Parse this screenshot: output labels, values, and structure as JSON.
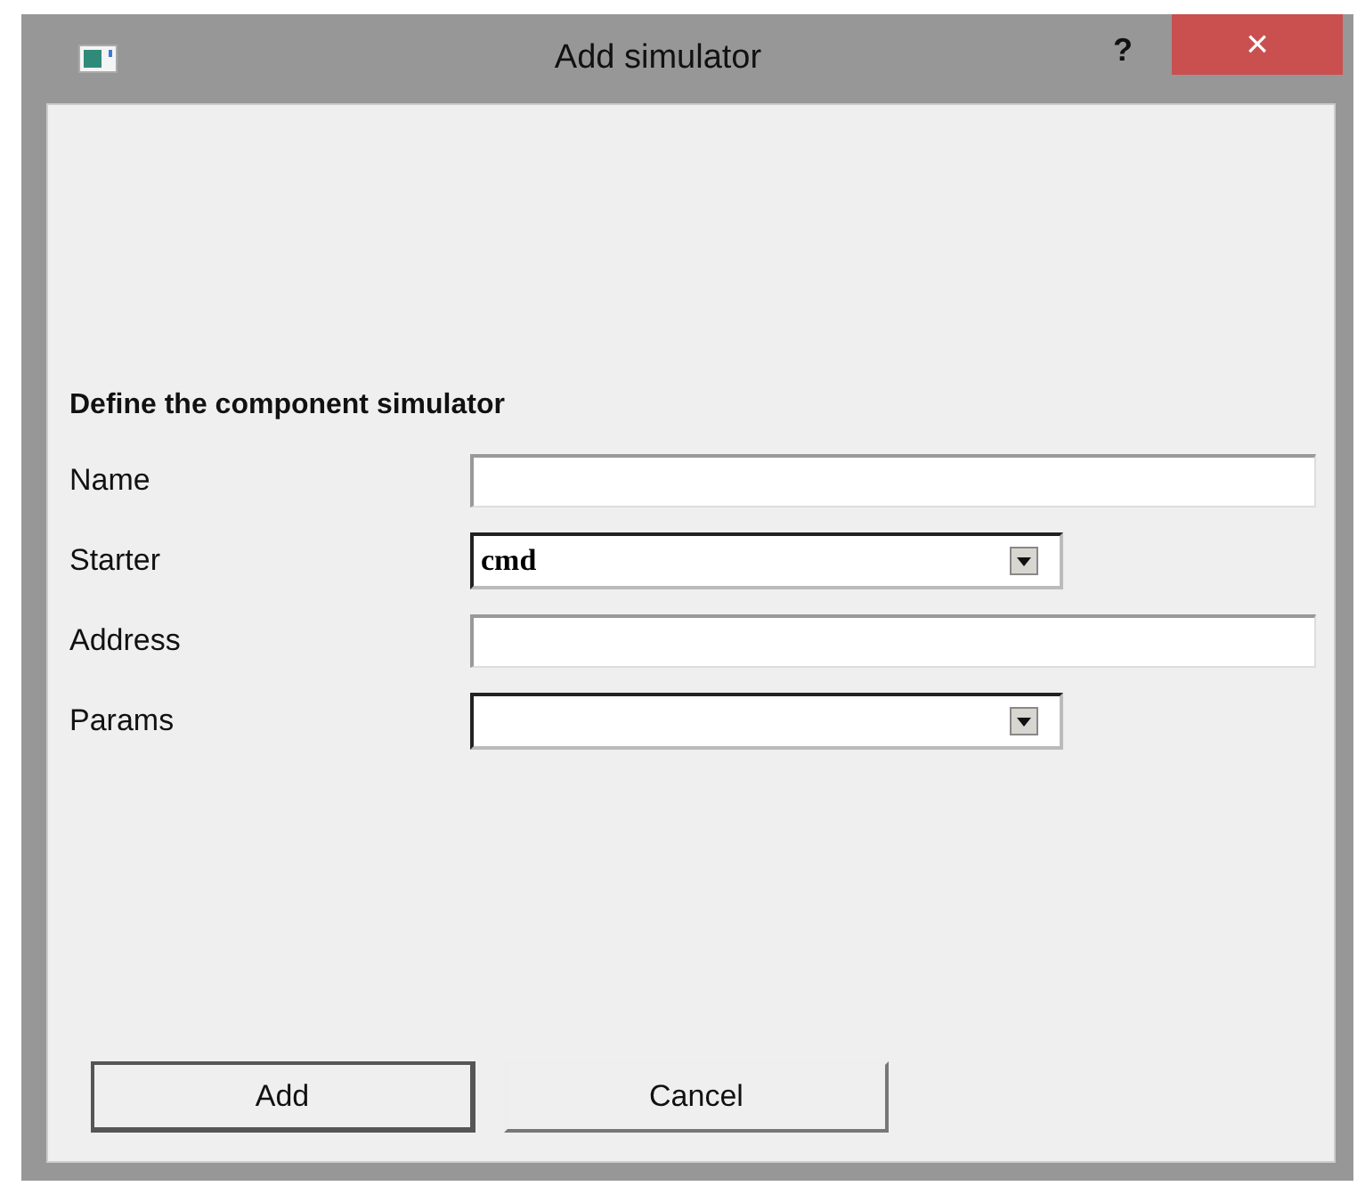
{
  "window": {
    "title": "Add simulator",
    "help": "?",
    "close": "×"
  },
  "form": {
    "heading": "Define the component simulator",
    "fields": [
      {
        "label": "Name",
        "kind": "text"
      },
      {
        "label": "Starter",
        "kind": "combo",
        "value": "cmd"
      },
      {
        "label": "Address",
        "kind": "text"
      },
      {
        "label": "Params",
        "kind": "combo"
      }
    ]
  },
  "buttons": [
    {
      "label": "Add",
      "default": true
    },
    {
      "label": "Cancel",
      "default": false
    }
  ]
}
